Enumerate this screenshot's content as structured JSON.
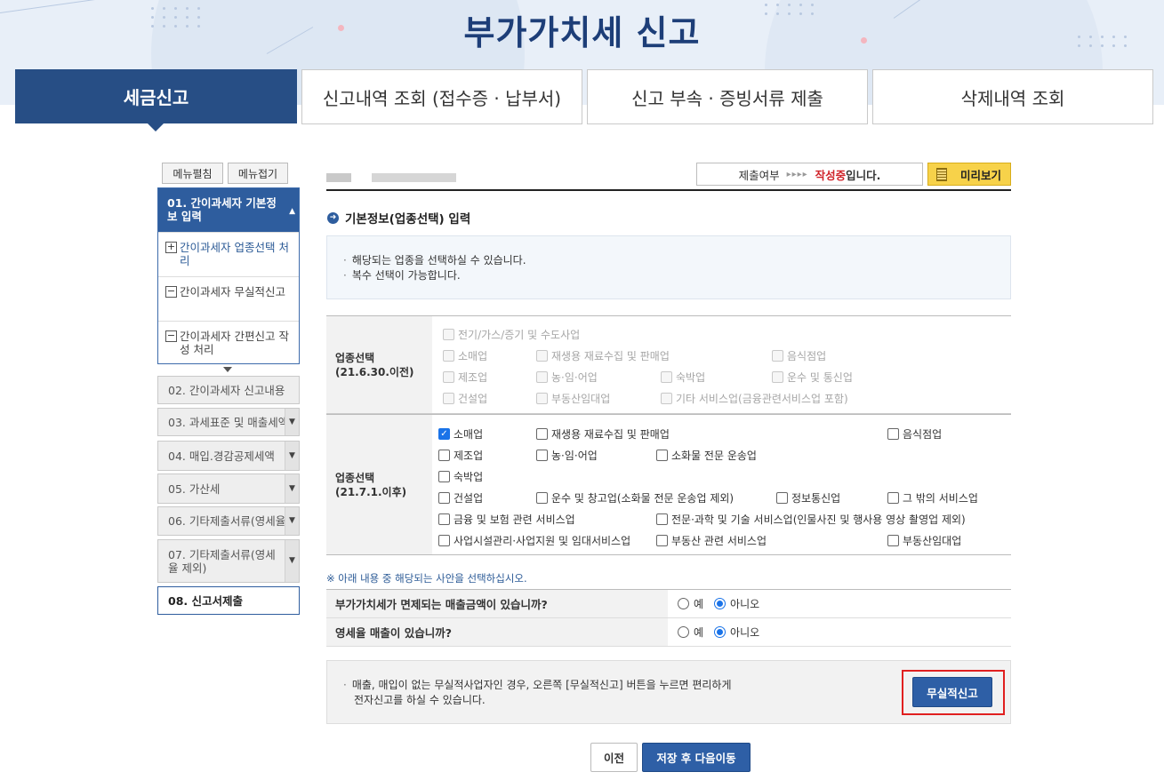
{
  "page": {
    "title": "부가가치세 신고"
  },
  "tabs": [
    {
      "label": "세금신고",
      "active": true
    },
    {
      "label": "신고내역 조회 (접수증 · 납부서)"
    },
    {
      "label": "신고 부속 · 증빙서류 제출"
    },
    {
      "label": "삭제내역 조회"
    }
  ],
  "sidebar": {
    "expand_label": "메뉴펼침",
    "collapse_label": "메뉴접기",
    "open_step": {
      "label": "01. 간이과세자 기본정보 입력",
      "items": [
        {
          "icon": "+",
          "label": "간이과세자 업종선택 처리"
        },
        {
          "icon": "−",
          "label": "간이과세자 무실적신고"
        },
        {
          "icon": "−",
          "label": "간이과세자 간편신고 작성 처리"
        }
      ]
    },
    "steps": [
      {
        "label": "02. 간이과세자 신고내용"
      },
      {
        "label": "03. 과세표준 및 매출세액"
      },
      {
        "label": "04. 매입.경감공제세액"
      },
      {
        "label": "05. 가산세"
      },
      {
        "label": "06. 기타제출서류(영세율"
      },
      {
        "label": "07. 기타제출서류(영세율 제외)"
      },
      {
        "label": "08. 신고서제출"
      }
    ]
  },
  "status": {
    "label": "제출여부",
    "arrows": "▸▸▸▸",
    "value": "작성중",
    "suffix": "입니다."
  },
  "preview_label": "미리보기",
  "section": {
    "title": "기본정보(업종선택) 입력",
    "info_lines": [
      "해당되는 업종을 선택하실 수 있습니다.",
      "복수 선택이 가능합니다."
    ]
  },
  "industry_old": {
    "label1": "업종선택",
    "label2": "(21.6.30.이전)",
    "items": [
      {
        "label": "전기/가스/증기 및 수도사업",
        "checked": false
      },
      {
        "label": "소매업",
        "checked": false
      },
      {
        "label": "재생용 재료수집 및 판매업",
        "checked": false
      },
      {
        "label": "음식점업",
        "checked": false
      },
      {
        "label": "제조업",
        "checked": false
      },
      {
        "label": "농·임·어업",
        "checked": false
      },
      {
        "label": "숙박업",
        "checked": false
      },
      {
        "label": "운수 및 통신업",
        "checked": false
      },
      {
        "label": "건설업",
        "checked": false
      },
      {
        "label": "부동산임대업",
        "checked": false
      },
      {
        "label": "기타 서비스업(금융관련서비스업 포함)",
        "checked": false
      }
    ]
  },
  "industry_new": {
    "label1": "업종선택",
    "label2": "(21.7.1.이후)",
    "items": [
      {
        "label": "소매업",
        "checked": true
      },
      {
        "label": "재생용 재료수집 및 판매업",
        "checked": false
      },
      {
        "label": "음식점업",
        "checked": false
      },
      {
        "label": "제조업",
        "checked": false
      },
      {
        "label": "농·임·어업",
        "checked": false
      },
      {
        "label": "소화물 전문 운송업",
        "checked": false
      },
      {
        "label": "숙박업",
        "checked": false
      },
      {
        "label": "건설업",
        "checked": false
      },
      {
        "label": "운수 및 창고업(소화물 전문 운송업 제외)",
        "checked": false
      },
      {
        "label": "정보통신업",
        "checked": false
      },
      {
        "label": "그 밖의 서비스업",
        "checked": false
      },
      {
        "label": "금융 및 보험 관련 서비스업",
        "checked": false
      },
      {
        "label": "전문·과학 및 기술 서비스업(인물사진 및 행사용 영상 촬영업 제외)",
        "checked": false
      },
      {
        "label": "사업시설관리·사업지원 및 임대서비스업",
        "checked": false
      },
      {
        "label": "부동산 관련 서비스업",
        "checked": false
      },
      {
        "label": "부동산임대업",
        "checked": false
      }
    ]
  },
  "note": "※ 아래 내용 중 해당되는 사안을 선택하십시오.",
  "questions": [
    {
      "text": "부가가치세가 면제되는 매출금액이 있습니까?",
      "yes": "예",
      "no": "아니오",
      "selected": "no"
    },
    {
      "text": "영세율 매출이 있습니까?",
      "yes": "예",
      "no": "아니오",
      "selected": "no"
    }
  ],
  "zero_report": {
    "line1": "매출, 매입이 없는 무실적사업자인 경우, 오른쪽 [무실적신고] 버튼을 누르면 편리하게",
    "line2": "전자신고를 하실 수 있습니다.",
    "button": "무실적신고"
  },
  "footer": {
    "prev_label": "이전",
    "next_label": "저장 후 다음이동"
  },
  "colors": {
    "primary": "#274e85",
    "accent_red": "#d0242a",
    "highlight": "#f7d24a"
  }
}
